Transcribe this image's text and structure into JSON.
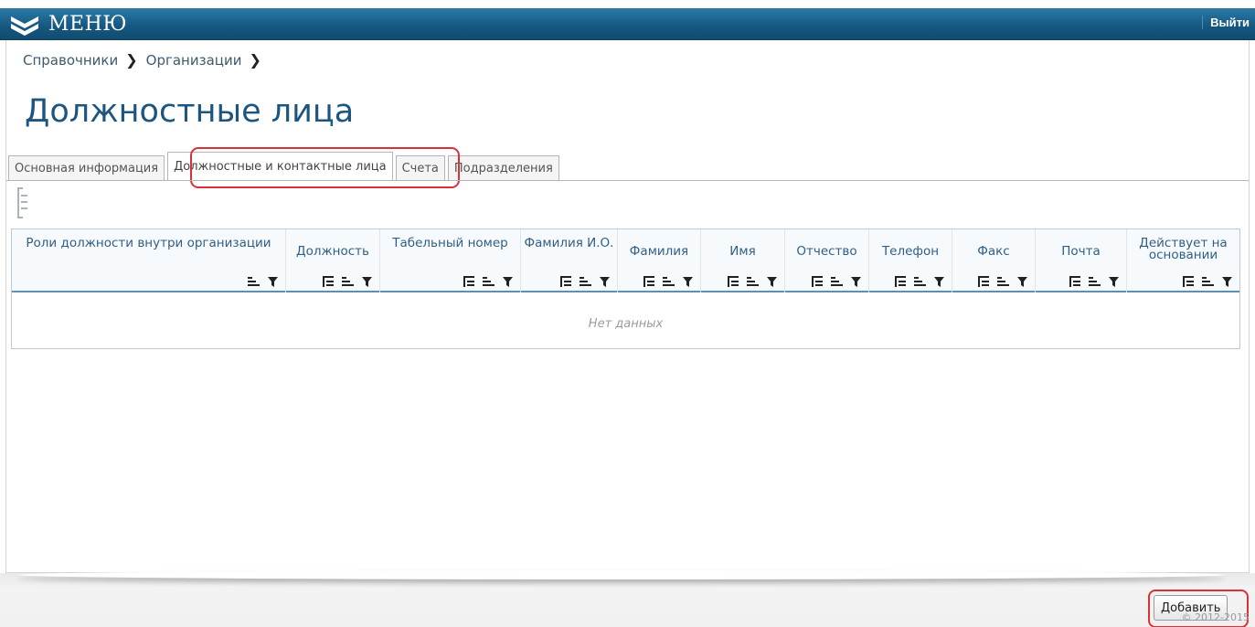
{
  "topbar": {
    "menu_label": "МЕНЮ",
    "logout_label": "Выйти"
  },
  "breadcrumb": [
    "Справочники",
    "Организации"
  ],
  "page_title": "Должностные лица",
  "tabs": [
    "Основная информация",
    "Должностные и контактные лица",
    "Счета",
    "Подразделения"
  ],
  "active_tab": "Должностные и контактные лица",
  "grid": {
    "columns": [
      {
        "label": "Роли должности внутри организации"
      },
      {
        "label": "Должность"
      },
      {
        "label": "Табельный номер"
      },
      {
        "label": "Фамилия И.О."
      },
      {
        "label": "Фамилия"
      },
      {
        "label": "Имя"
      },
      {
        "label": "Отчество"
      },
      {
        "label": "Телефон"
      },
      {
        "label": "Факс"
      },
      {
        "label": "Почта"
      },
      {
        "label": "Действует на основании"
      }
    ],
    "empty_text": "Нет данных"
  },
  "footer": {
    "add_label": "Добавить",
    "copyright": "© 2012-2015"
  },
  "colors": {
    "header": "#1a5f89",
    "title": "#1c5580",
    "highlight": "#d9313a"
  }
}
